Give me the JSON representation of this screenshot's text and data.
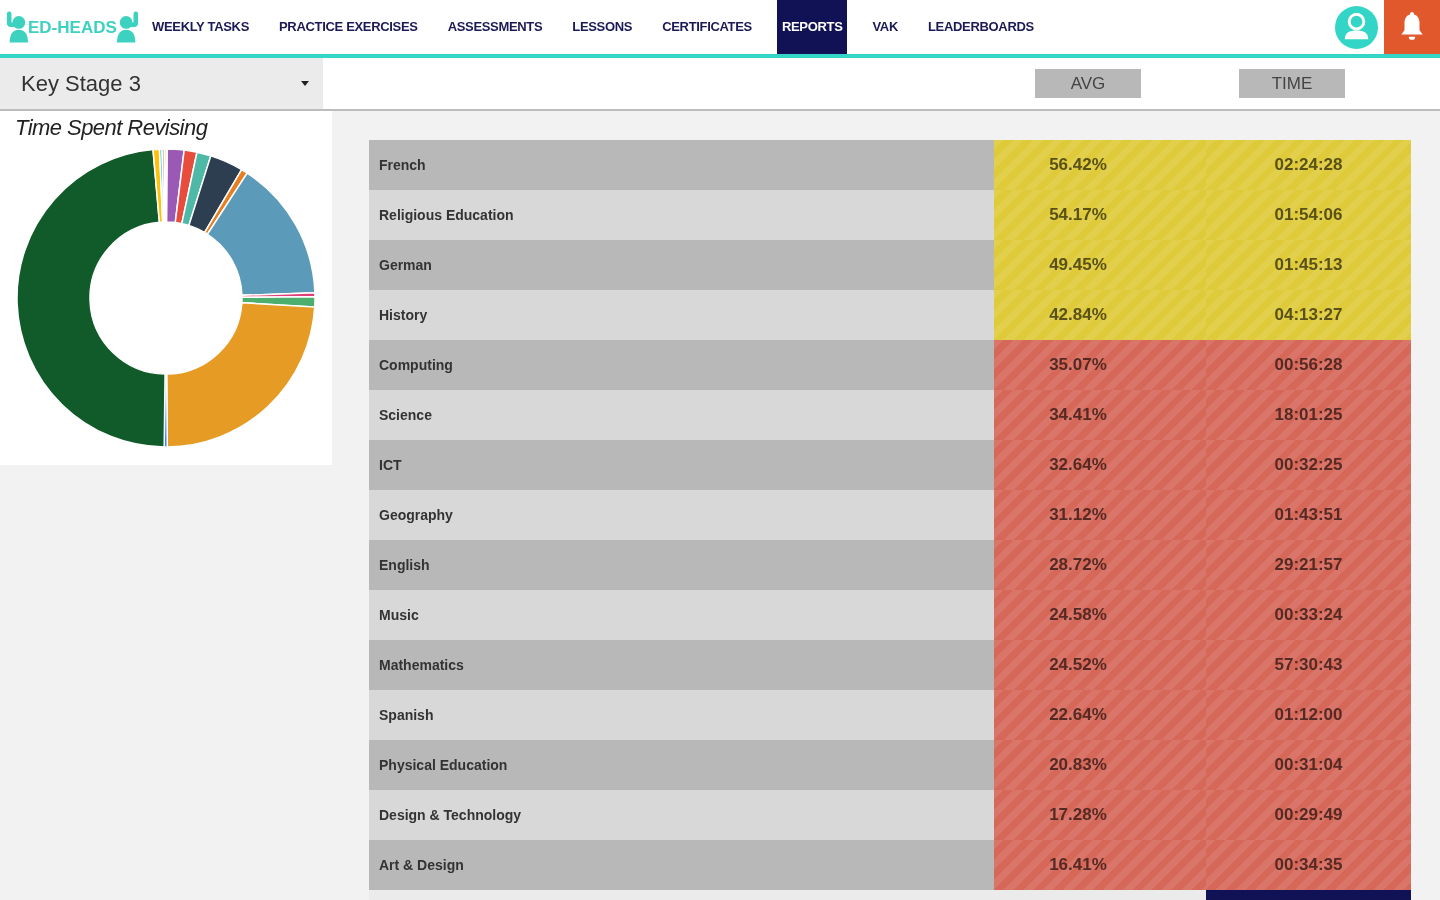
{
  "logo": {
    "text": "ED-HEADS"
  },
  "nav": {
    "items": [
      {
        "label": "WEEKLY TASKS",
        "selected": false
      },
      {
        "label": "PRACTICE EXERCISES",
        "selected": false
      },
      {
        "label": "ASSESSMENTS",
        "selected": false
      },
      {
        "label": "LESSONS",
        "selected": false
      },
      {
        "label": "CERTIFICATES",
        "selected": false
      },
      {
        "label": "REPORTS",
        "selected": true
      },
      {
        "label": "VAK",
        "selected": false
      },
      {
        "label": "LEADERBOARDS",
        "selected": false
      }
    ]
  },
  "key_stage_select": {
    "value": "Key Stage 3"
  },
  "column_buttons": [
    {
      "label": "AVG"
    },
    {
      "label": "TIME"
    }
  ],
  "chart_panel": {
    "title": "Time Spent Revising"
  },
  "table": {
    "rows": [
      {
        "subject": "French",
        "avg": "56.42%",
        "time": "02:24:28",
        "color": "#dfcb3a"
      },
      {
        "subject": "Religious Education",
        "avg": "54.17%",
        "time": "01:54:06",
        "color": "#dfcb3a"
      },
      {
        "subject": "German",
        "avg": "49.45%",
        "time": "01:45:13",
        "color": "#dfcb3a"
      },
      {
        "subject": "History",
        "avg": "42.84%",
        "time": "04:13:27",
        "color": "#dfcb3a"
      },
      {
        "subject": "Computing",
        "avg": "35.07%",
        "time": "00:56:28",
        "color": "#d6685a"
      },
      {
        "subject": "Science",
        "avg": "34.41%",
        "time": "18:01:25",
        "color": "#d6685a"
      },
      {
        "subject": "ICT",
        "avg": "32.64%",
        "time": "00:32:25",
        "color": "#d6685a"
      },
      {
        "subject": "Geography",
        "avg": "31.12%",
        "time": "01:43:51",
        "color": "#d6685a"
      },
      {
        "subject": "English",
        "avg": "28.72%",
        "time": "29:21:57",
        "color": "#d6685a"
      },
      {
        "subject": "Music",
        "avg": "24.58%",
        "time": "00:33:24",
        "color": "#d6685a"
      },
      {
        "subject": "Mathematics",
        "avg": "24.52%",
        "time": "57:30:43",
        "color": "#d6685a"
      },
      {
        "subject": "Spanish",
        "avg": "22.64%",
        "time": "01:12:00",
        "color": "#d6685a"
      },
      {
        "subject": "Physical Education",
        "avg": "20.83%",
        "time": "00:31:04",
        "color": "#d6685a"
      },
      {
        "subject": "Design & Technology",
        "avg": "17.28%",
        "time": "00:29:49",
        "color": "#d6685a"
      },
      {
        "subject": "Art & Design",
        "avg": "16.41%",
        "time": "00:34:35",
        "color": "#d6685a"
      }
    ]
  }
}
